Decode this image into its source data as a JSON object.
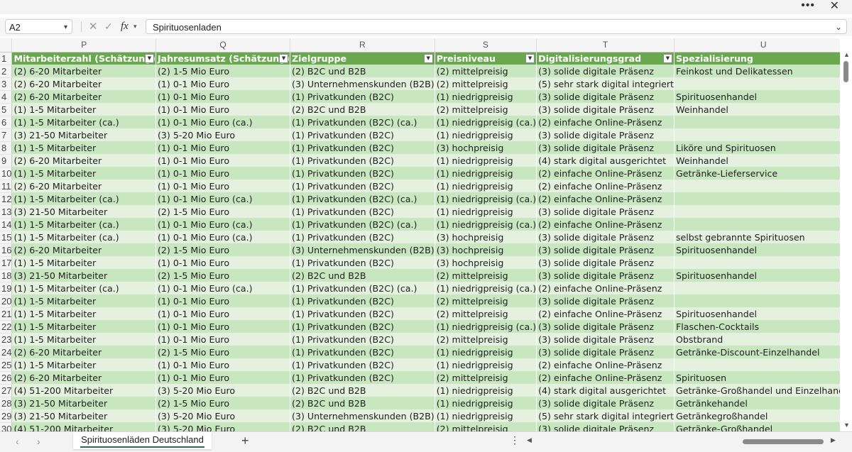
{
  "window": {
    "more_label": "•••",
    "close_label": "✕"
  },
  "formula_bar": {
    "name_box": "A2",
    "formula": "Spirituosenladen"
  },
  "columns": [
    "P",
    "Q",
    "R",
    "S",
    "T",
    "U"
  ],
  "headers": [
    "Mitarbeiterzahl (Schätzung)",
    "Jahresumsatz (Schätzung)",
    "Zielgruppe",
    "Preisniveau",
    "Digitalisierungsgrad",
    "Spezialisierung"
  ],
  "rows": [
    {
      "n": "2",
      "cells": [
        "(2) 6-20 Mitarbeiter",
        "(2) 1-5 Mio Euro",
        "(2) B2C und B2B",
        "(2) mittelpreisig",
        "(3) solide digitale Präsenz",
        "Feinkost und Delikatessen"
      ]
    },
    {
      "n": "3",
      "cells": [
        "(2) 6-20 Mitarbeiter",
        "(1) 0-1 Mio Euro",
        "(3) Unternehmenskunden (B2B)",
        "(2) mittelpreisig",
        "(5) sehr stark digital integriert",
        ""
      ]
    },
    {
      "n": "4",
      "cells": [
        "(2) 6-20 Mitarbeiter",
        "(1) 0-1 Mio Euro",
        "(1) Privatkunden (B2C)",
        "(1) niedrigpreisig",
        "(3) solide digitale Präsenz",
        "Spirituosenhandel"
      ]
    },
    {
      "n": "5",
      "cells": [
        "(1) 1-5 Mitarbeiter",
        "(1) 0-1 Mio Euro",
        "(2) B2C und B2B",
        "(2) mittelpreisig",
        "(3) solide digitale Präsenz",
        "Weinhandel"
      ]
    },
    {
      "n": "6",
      "cells": [
        "(1) 1-5 Mitarbeiter (ca.)",
        "(1) 0-1 Mio Euro (ca.)",
        "(1) Privatkunden (B2C) (ca.)",
        "(1) niedrigpreisig (ca.)",
        "(2) einfache Online-Präsenz",
        ""
      ]
    },
    {
      "n": "7",
      "cells": [
        "(3) 21-50 Mitarbeiter",
        "(3) 5-20 Mio Euro",
        "(1) Privatkunden (B2C)",
        "(1) niedrigpreisig",
        "(3) solide digitale Präsenz",
        ""
      ]
    },
    {
      "n": "8",
      "cells": [
        "(1) 1-5 Mitarbeiter",
        "(1) 0-1 Mio Euro",
        "(1) Privatkunden (B2C)",
        "(3) hochpreisig",
        "(3) solide digitale Präsenz",
        "Liköre und Spirituosen"
      ]
    },
    {
      "n": "9",
      "cells": [
        "(2) 6-20 Mitarbeiter",
        "(1) 0-1 Mio Euro",
        "(1) Privatkunden (B2C)",
        "(1) niedrigpreisig",
        "(4) stark digital ausgerichtet",
        "Weinhandel"
      ]
    },
    {
      "n": "10",
      "cells": [
        "(1) 1-5 Mitarbeiter",
        "(1) 0-1 Mio Euro",
        "(1) Privatkunden (B2C)",
        "(1) niedrigpreisig",
        "(2) einfache Online-Präsenz",
        "Getränke-Lieferservice"
      ]
    },
    {
      "n": "11",
      "cells": [
        "(2) 6-20 Mitarbeiter",
        "(1) 0-1 Mio Euro",
        "(1) Privatkunden (B2C)",
        "(1) niedrigpreisig",
        "(2) einfache Online-Präsenz",
        ""
      ]
    },
    {
      "n": "12",
      "cells": [
        "(1) 1-5 Mitarbeiter (ca.)",
        "(1) 0-1 Mio Euro (ca.)",
        "(1) Privatkunden (B2C) (ca.)",
        "(1) niedrigpreisig (ca.)",
        "(2) einfache Online-Präsenz",
        ""
      ]
    },
    {
      "n": "13",
      "cells": [
        "(3) 21-50 Mitarbeiter",
        "(2) 1-5 Mio Euro",
        "(1) Privatkunden (B2C)",
        "(1) niedrigpreisig",
        "(3) solide digitale Präsenz",
        ""
      ]
    },
    {
      "n": "14",
      "cells": [
        "(1) 1-5 Mitarbeiter (ca.)",
        "(1) 0-1 Mio Euro (ca.)",
        "(1) Privatkunden (B2C) (ca.)",
        "(1) niedrigpreisig (ca.)",
        "(2) einfache Online-Präsenz",
        ""
      ]
    },
    {
      "n": "15",
      "cells": [
        "(1) 1-5 Mitarbeiter (ca.)",
        "(1) 0-1 Mio Euro (ca.)",
        "(1) Privatkunden (B2C)",
        "(3) hochpreisig",
        "(3) solide digitale Präsenz",
        "selbst gebrannte Spirituosen"
      ]
    },
    {
      "n": "16",
      "cells": [
        "(2) 6-20 Mitarbeiter",
        "(2) 1-5 Mio Euro",
        "(3) Unternehmenskunden (B2B)",
        "(3) hochpreisig",
        "(3) solide digitale Präsenz",
        "Spirituosenhandel"
      ]
    },
    {
      "n": "17",
      "cells": [
        "(1) 1-5 Mitarbeiter",
        "(1) 0-1 Mio Euro",
        "(1) Privatkunden (B2C)",
        "(3) hochpreisig",
        "(3) solide digitale Präsenz",
        ""
      ]
    },
    {
      "n": "18",
      "cells": [
        "(3) 21-50 Mitarbeiter",
        "(2) 1-5 Mio Euro",
        "(2) B2C und B2B",
        "(2) mittelpreisig",
        "(3) solide digitale Präsenz",
        "Spirituosenhandel"
      ]
    },
    {
      "n": "19",
      "cells": [
        "(1) 1-5 Mitarbeiter (ca.)",
        "(1) 0-1 Mio Euro (ca.)",
        "(1) Privatkunden (B2C) (ca.)",
        "(1) niedrigpreisig (ca.)",
        "(2) einfache Online-Präsenz",
        ""
      ]
    },
    {
      "n": "20",
      "cells": [
        "(1) 1-5 Mitarbeiter",
        "(1) 0-1 Mio Euro",
        "(1) Privatkunden (B2C)",
        "(2) mittelpreisig",
        "(3) solide digitale Präsenz",
        ""
      ]
    },
    {
      "n": "21",
      "cells": [
        "(1) 1-5 Mitarbeiter",
        "(1) 0-1 Mio Euro",
        "(1) Privatkunden (B2C)",
        "(2) mittelpreisig",
        "(2) einfache Online-Präsenz",
        "Spirituosenhandel"
      ]
    },
    {
      "n": "22",
      "cells": [
        "(1) 1-5 Mitarbeiter",
        "(1) 0-1 Mio Euro",
        "(1) Privatkunden (B2C)",
        "(1) niedrigpreisig (ca.)",
        "(3) solide digitale Präsenz",
        "Flaschen-Cocktails"
      ]
    },
    {
      "n": "23",
      "cells": [
        "(1) 1-5 Mitarbeiter",
        "(1) 0-1 Mio Euro",
        "(1) Privatkunden (B2C)",
        "(2) mittelpreisig",
        "(3) solide digitale Präsenz",
        "Obstbrand"
      ]
    },
    {
      "n": "24",
      "cells": [
        "(2) 6-20 Mitarbeiter",
        "(2) 1-5 Mio Euro",
        "(1) Privatkunden (B2C)",
        "(1) niedrigpreisig",
        "(3) solide digitale Präsenz",
        "Getränke-Discount-Einzelhandel"
      ]
    },
    {
      "n": "25",
      "cells": [
        "(1) 1-5 Mitarbeiter",
        "(1) 0-1 Mio Euro",
        "(1) Privatkunden (B2C)",
        "(1) niedrigpreisig",
        "(2) einfache Online-Präsenz",
        ""
      ]
    },
    {
      "n": "26",
      "cells": [
        "(2) 6-20 Mitarbeiter",
        "(1) 0-1 Mio Euro",
        "(1) Privatkunden (B2C)",
        "(2) mittelpreisig",
        "(2) einfache Online-Präsenz",
        "Spirituosen"
      ]
    },
    {
      "n": "27",
      "cells": [
        "(4) 51-200 Mitarbeiter",
        "(3) 5-20 Mio Euro",
        "(2) B2C und B2B",
        "(1) niedrigpreisig",
        "(4) stark digital ausgerichtet",
        "Getränke-Großhandel und Einzelhandel"
      ]
    },
    {
      "n": "28",
      "cells": [
        "(3) 21-50 Mitarbeiter",
        "(2) 1-5 Mio Euro",
        "(2) B2C und B2B",
        "(1) niedrigpreisig",
        "(3) solide digitale Präsenz",
        "Getränkehandel"
      ]
    },
    {
      "n": "29",
      "cells": [
        "(3) 21-50 Mitarbeiter",
        "(3) 5-20 Mio Euro",
        "(3) Unternehmenskunden (B2B)",
        "(1) niedrigpreisig",
        "(5) sehr stark digital integriert",
        "Getränkegroßhandel"
      ]
    },
    {
      "n": "30",
      "cells": [
        "(4) 51-200 Mitarbeiter",
        "(3) 5-20 Mio Euro",
        "(2) B2C und B2B",
        "(2) mittelpreisig",
        "(3) solide digitale Präsenz",
        "Getränke-Großhandel"
      ]
    }
  ],
  "sheet_tabs": {
    "active": "Spirituosenläden Deutschland",
    "add_label": "+"
  },
  "colors": {
    "header_green": "#6aa84f",
    "band_dark": "#c8e6c0",
    "band_light": "#e4f1df",
    "tab_underline": "#217346"
  }
}
